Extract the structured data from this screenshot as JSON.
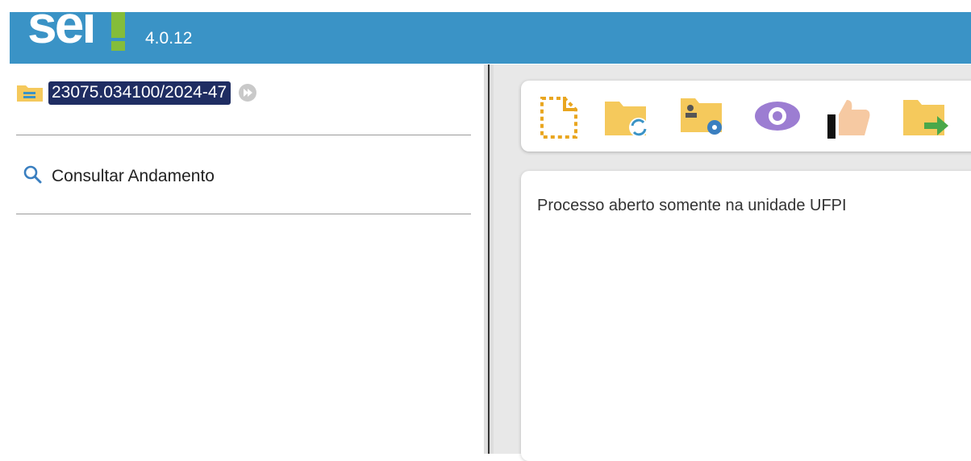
{
  "header": {
    "logo_text": "sei",
    "version": "4.0.12",
    "colors": {
      "bar": "#3a93c6",
      "logo_accent": "#84bd3a"
    }
  },
  "sidebar": {
    "process_number": "23075.034100/2024-47",
    "consult_label": "Consultar Andamento",
    "icons": [
      "folder-icon",
      "fast-forward-icon",
      "search-icon"
    ]
  },
  "toolbar": {
    "icons": [
      "new-document-icon",
      "reopen-process-icon",
      "assign-process-icon",
      "view-icon",
      "like-icon",
      "send-process-icon"
    ]
  },
  "main": {
    "status_text": "Processo aberto somente na unidade UFPI"
  },
  "colors": {
    "process_badge": "#1f2d62",
    "folder": "#f5c95c"
  }
}
